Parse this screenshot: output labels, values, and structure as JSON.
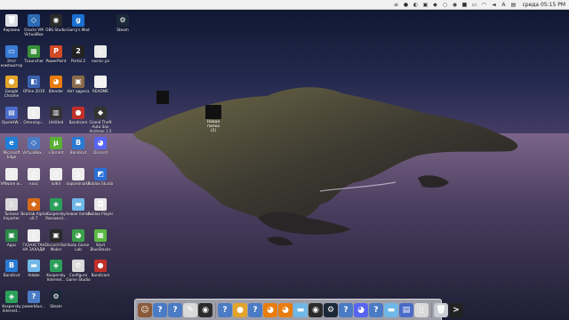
{
  "menubar": {
    "clock": "среда 05:15 PM",
    "tray_icons": [
      {
        "name": "menu-list-icon",
        "glyph": "≡"
      },
      {
        "name": "app-tray-icon-1",
        "glyph": "●"
      },
      {
        "name": "app-tray-icon-2",
        "glyph": "◐"
      },
      {
        "name": "app-tray-icon-3",
        "glyph": "▣"
      },
      {
        "name": "app-tray-icon-4",
        "glyph": "◆"
      },
      {
        "name": "app-tray-icon-5",
        "glyph": "○"
      },
      {
        "name": "app-tray-icon-6",
        "glyph": "◉"
      },
      {
        "name": "app-tray-icon-7",
        "glyph": "■"
      },
      {
        "name": "battery-icon",
        "glyph": "▭"
      },
      {
        "name": "wifi-icon",
        "glyph": "◠"
      },
      {
        "name": "volume-icon",
        "glyph": "◄"
      },
      {
        "name": "lang-icon",
        "glyph": "A"
      },
      {
        "name": "notification-icon",
        "glyph": "▤"
      }
    ]
  },
  "desktop_icons": [
    {
      "label": "Корзина",
      "icon": "trash-icon",
      "color": "#d9dde3",
      "glyph": "🗑"
    },
    {
      "label": "Oracle VM VirtualBox",
      "icon": "virtualbox-icon",
      "color": "#2d6bb3",
      "glyph": "◇"
    },
    {
      "label": "OBS Studio",
      "icon": "obs-icon",
      "color": "#2b2b2b",
      "glyph": "◉"
    },
    {
      "label": "Garry's Mod",
      "icon": "gmod-icon",
      "color": "#1a6fd0",
      "glyph": "g"
    },
    {
      "label": "Steam",
      "icon": "steam-icon",
      "color": "#1b2838",
      "glyph": "⚙"
    },
    {
      "label": "Этот компьютер",
      "icon": "computer-icon",
      "color": "#3a7bd5",
      "glyph": "▭"
    },
    {
      "label": "TLauncher",
      "icon": "tlauncher-icon",
      "color": "#3a8f3a",
      "glyph": "▦"
    },
    {
      "label": "PowerPoint",
      "icon": "powerpoint-icon",
      "color": "#d04a25",
      "glyph": "P"
    },
    {
      "label": "Portal 2",
      "icon": "portal2-icon",
      "color": "#222",
      "glyph": "2"
    },
    {
      "label": "rasmic.jar",
      "icon": "file-icon",
      "color": "#eaeaea",
      "glyph": "▯"
    },
    {
      "label": "Google Chrome",
      "icon": "chrome-icon",
      "color": "#e2a42a",
      "glyph": "●"
    },
    {
      "label": "Ofline 2019",
      "icon": "file-icon",
      "color": "#3a62b0",
      "glyph": "◧"
    },
    {
      "label": "Blender",
      "icon": "blender-icon",
      "color": "#e87d0d",
      "glyph": "◕"
    },
    {
      "label": "Нет адреса",
      "icon": "photo-icon",
      "color": "#8a6a4a",
      "glyph": "▣"
    },
    {
      "label": "README",
      "icon": "document-icon",
      "color": "#f2f2f2",
      "glyph": "▯"
    },
    {
      "label": "OpenHW...",
      "icon": "app-icon",
      "color": "#4a6cc8",
      "glyph": "▤"
    },
    {
      "label": "Опенлар...",
      "icon": "document-icon",
      "color": "#eee",
      "glyph": "▯"
    },
    {
      "label": "Untitled",
      "icon": "app-icon",
      "color": "#333",
      "glyph": "▥"
    },
    {
      "label": "Bandicam",
      "icon": "bandicam-icon",
      "color": "#c0302a",
      "glyph": "●"
    },
    {
      "label": "Grand Theft Auto San Andreas 1.5",
      "icon": "gta-icon",
      "color": "#333",
      "glyph": "◆"
    },
    {
      "label": "Microsoft Edge",
      "icon": "edge-icon",
      "color": "#1f7fd8",
      "glyph": "e"
    },
    {
      "label": "VirtualBox...",
      "icon": "virtualbox-icon",
      "color": "#4a7bc4",
      "glyph": "◇"
    },
    {
      "label": "uTorrent",
      "icon": "utorrent-icon",
      "color": "#5ab033",
      "glyph": "µ"
    },
    {
      "label": "Bandicut",
      "icon": "bandicut-icon",
      "color": "#2a7ad4",
      "glyph": "B"
    },
    {
      "label": "Discord",
      "icon": "discord-icon",
      "color": "#5865f2",
      "glyph": "◕"
    },
    {
      "label": "VMware w...",
      "icon": "document-icon",
      "color": "#eee",
      "glyph": "▯"
    },
    {
      "label": "кхос",
      "icon": "document-icon",
      "color": "#eee",
      "glyph": "▯"
    },
    {
      "label": "lol64",
      "icon": "document-icon",
      "color": "#eee",
      "glyph": "▯"
    },
    {
      "label": "napominalka",
      "icon": "document-icon",
      "color": "#eee",
      "glyph": "▯"
    },
    {
      "label": "Roblox Studio",
      "icon": "roblox-studio-icon",
      "color": "#2a6fd8",
      "glyph": "◩"
    },
    {
      "label": "Turbose Importer",
      "icon": "app-icon",
      "color": "#d9d9d9",
      "glyph": "▯"
    },
    {
      "label": "Bearlab Alpha v0.7",
      "icon": "app-icon",
      "color": "#d46a1a",
      "glyph": "◆"
    },
    {
      "label": "Kaspersky Password...",
      "icon": "kaspersky-icon",
      "color": "#2aa05a",
      "glyph": "◈"
    },
    {
      "label": "Новая папка",
      "icon": "folder-icon",
      "color": "#6fb8e8",
      "glyph": "▬"
    },
    {
      "label": "Roblox Player",
      "icon": "roblox-icon",
      "color": "#e8e8e8",
      "glyph": "◘"
    },
    {
      "label": "Apps",
      "icon": "app-icon",
      "color": "#2a8a4a",
      "glyph": "▣"
    },
    {
      "label": "ГАЗАХСТАН НА ЗАХАДИ",
      "icon": "document-icon",
      "color": "#eee",
      "glyph": "▯"
    },
    {
      "label": "Discord Bot Maker",
      "icon": "app-icon",
      "color": "#2a2a2a",
      "glyph": "▣"
    },
    {
      "label": "Kodu Game Lab",
      "icon": "kodu-icon",
      "color": "#3aa04a",
      "glyph": "◕"
    },
    {
      "label": "Start BlueStacks",
      "icon": "bluestacks-icon",
      "color": "#5ab843",
      "glyph": "▦"
    },
    {
      "label": "Bandicut",
      "icon": "bandicut-icon",
      "color": "#2a7ad4",
      "glyph": "B"
    },
    {
      "label": "Adobe",
      "icon": "folder-icon",
      "color": "#6fb8e8",
      "glyph": "▬"
    },
    {
      "label": "Kaspersky Internet...",
      "icon": "kaspersky-icon",
      "color": "#2aa05a",
      "glyph": "◈"
    },
    {
      "label": "Configure Game Studio",
      "icon": "app-icon",
      "color": "#d9d9d9",
      "glyph": "⚙"
    },
    {
      "label": "Bandicam",
      "icon": "bandicam-icon",
      "color": "#c0302a",
      "glyph": "●"
    },
    {
      "label": "Kaspersky Internet...",
      "icon": "kaspersky-icon",
      "color": "#2aa05a",
      "glyph": "◈"
    },
    {
      "label": "powerkbur...",
      "icon": "question-icon",
      "color": "#4a7bc4",
      "glyph": "?"
    },
    {
      "label": "Steam",
      "icon": "steam-icon",
      "color": "#1b2838",
      "glyph": "⚙"
    }
  ],
  "selected_items": [
    {
      "label": "Новая папка",
      "sub": "(2)"
    }
  ],
  "dock": [
    {
      "name": "finder-icon",
      "color": "#8a5a3a",
      "glyph": "☺"
    },
    {
      "name": "help-icon",
      "color": "#4a7bc4",
      "glyph": "?"
    },
    {
      "name": "help-icon-2",
      "color": "#4a7bc4",
      "glyph": "?"
    },
    {
      "name": "script-icon",
      "color": "#d9d9d9",
      "glyph": "✎"
    },
    {
      "name": "obs-icon",
      "color": "#2b2b2b",
      "glyph": "◉"
    },
    {
      "name": "help-icon-3",
      "color": "#4a7bc4",
      "glyph": "?"
    },
    {
      "name": "chrome-icon",
      "color": "#e2a42a",
      "glyph": "●"
    },
    {
      "name": "help-icon-4",
      "color": "#4a7bc4",
      "glyph": "?"
    },
    {
      "name": "blender-icon",
      "color": "#e87d0d",
      "glyph": "◕"
    },
    {
      "name": "blender-icon-2",
      "color": "#e87d0d",
      "glyph": "◕"
    },
    {
      "name": "folder-icon",
      "color": "#6fb8e8",
      "glyph": "▬"
    },
    {
      "name": "obs-icon-2",
      "color": "#2b2b2b",
      "glyph": "◉"
    },
    {
      "name": "steam-icon",
      "color": "#1b2838",
      "glyph": "⚙"
    },
    {
      "name": "help-icon-5",
      "color": "#4a7bc4",
      "glyph": "?"
    },
    {
      "name": "discord-icon",
      "color": "#5865f2",
      "glyph": "◕"
    },
    {
      "name": "help-icon-6",
      "color": "#4a7bc4",
      "glyph": "?"
    },
    {
      "name": "folder-icon-2",
      "color": "#6fb8e8",
      "glyph": "▬"
    },
    {
      "name": "app-icon",
      "color": "#4a6cc8",
      "glyph": "▤"
    },
    {
      "name": "notes-icon",
      "color": "#d9d9d9",
      "glyph": "▯"
    },
    {
      "name": "trash-icon",
      "color": "#c8ccd2",
      "glyph": "🗑"
    },
    {
      "name": "terminal-icon",
      "color": "#222",
      "glyph": ">"
    }
  ]
}
